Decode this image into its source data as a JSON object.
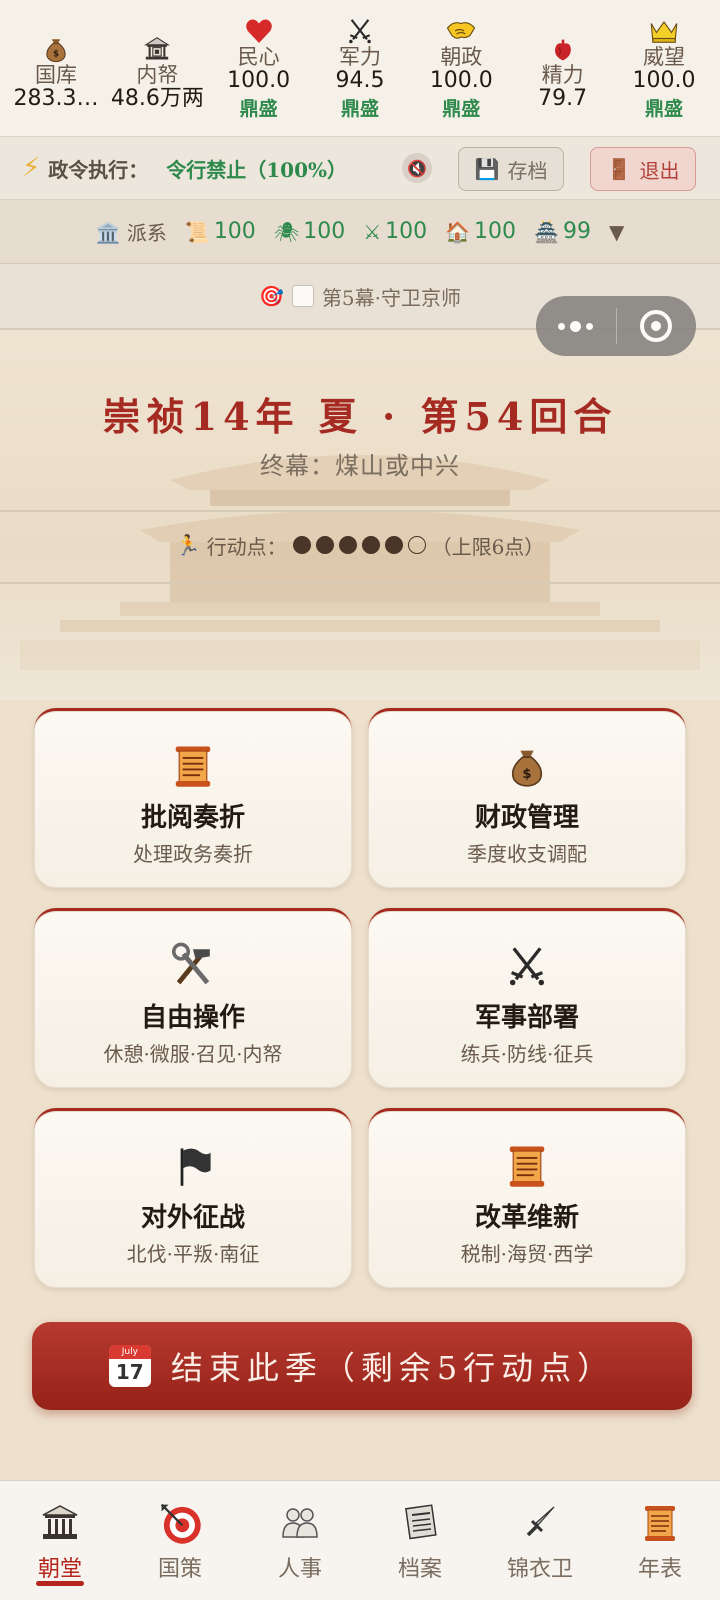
{
  "stats": [
    {
      "key": "treasury",
      "icon": "money-bag-icon",
      "label": "国库",
      "value": "283.3…",
      "status": ""
    },
    {
      "key": "privy",
      "icon": "bank-icon",
      "label": "内帑",
      "value": "48.6万两",
      "status": ""
    },
    {
      "key": "morale",
      "icon": "heart-icon",
      "label": "民心",
      "value": "100.0",
      "status": "鼎盛"
    },
    {
      "key": "military",
      "icon": "crossed-swords-icon",
      "label": "军力",
      "value": "94.5",
      "status": "鼎盛"
    },
    {
      "key": "court",
      "icon": "handshake-icon",
      "label": "朝政",
      "value": "100.0",
      "status": "鼎盛"
    },
    {
      "key": "energy",
      "icon": "anatomical-heart-icon",
      "label": "精力",
      "value": "79.7",
      "status": ""
    },
    {
      "key": "prestige",
      "icon": "crown-icon",
      "label": "威望",
      "value": "100.0",
      "status": "鼎盛"
    }
  ],
  "policy": {
    "label": "政令执行：",
    "value": "令行禁止（100%）",
    "save_label": "存档",
    "exit_label": "退出"
  },
  "faction": {
    "label": "派系",
    "items": [
      {
        "icon": "scroll-icon",
        "glyph": "📜",
        "value": "100"
      },
      {
        "icon": "spider-icon",
        "glyph": "🕷",
        "value": "100"
      },
      {
        "icon": "crossed-swords-icon",
        "glyph": "⚔",
        "value": "100"
      },
      {
        "icon": "house-icon",
        "glyph": "🏠",
        "value": "100"
      },
      {
        "icon": "pagoda-icon",
        "glyph": "🏯",
        "value": "99"
      }
    ]
  },
  "act": {
    "label": "第5幕·守卫京师"
  },
  "hero": {
    "turn_title": "崇祯14年 夏 · 第54回合",
    "finale": "终幕：煤山或中兴",
    "action_points_label": "行动点：",
    "action_points": 5,
    "action_points_max": 6,
    "action_points_suffix": "（上限6点）"
  },
  "cards": [
    {
      "name": "review-memorials",
      "icon": "scroll-icon",
      "title": "批阅奏折",
      "subtitle": "处理政务奏折"
    },
    {
      "name": "finance",
      "icon": "money-bag-icon",
      "title": "财政管理",
      "subtitle": "季度收支调配"
    },
    {
      "name": "free-action",
      "icon": "hammer-wrench-icon",
      "title": "自由操作",
      "subtitle": "休憩·微服·召见·内帑"
    },
    {
      "name": "military",
      "icon": "crossed-swords-icon",
      "title": "军事部署",
      "subtitle": "练兵·防线·征兵"
    },
    {
      "name": "campaign",
      "icon": "black-flag-icon",
      "title": "对外征战",
      "subtitle": "北伐·平叛·南征"
    },
    {
      "name": "reform",
      "icon": "scroll-icon",
      "title": "改革维新",
      "subtitle": "税制·海贸·西学"
    }
  ],
  "end_button": {
    "label": "结束此季（剩余5行动点）",
    "calendar_month": "July",
    "calendar_day": "17"
  },
  "nav": [
    {
      "key": "court",
      "icon": "classical-building-icon",
      "label": "朝堂",
      "active": true
    },
    {
      "key": "policy",
      "icon": "target-icon",
      "label": "国策",
      "active": false
    },
    {
      "key": "personnel",
      "icon": "people-icon",
      "label": "人事",
      "active": false
    },
    {
      "key": "archive",
      "icon": "newspaper-icon",
      "label": "档案",
      "active": false
    },
    {
      "key": "guard",
      "icon": "dagger-icon",
      "label": "锦衣卫",
      "active": false
    },
    {
      "key": "timeline",
      "icon": "scroll-icon",
      "label": "年表",
      "active": false
    }
  ],
  "colors": {
    "accent_red": "#a52a22",
    "status_green": "#2e8a4c",
    "background": "#ede1cd"
  }
}
